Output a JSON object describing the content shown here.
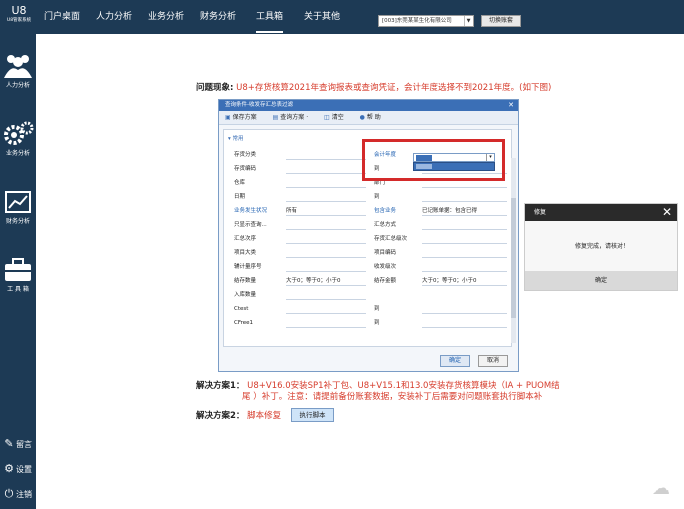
{
  "app": {
    "logo_mark": "U8",
    "logo_text": "U8管家系统"
  },
  "nav": {
    "items": [
      "门户桌面",
      "人力分析",
      "业务分析",
      "财务分析",
      "工具箱",
      "关于其他"
    ],
    "active": "工具箱"
  },
  "company_select": {
    "value": "[003]东莞某某生化有限公司"
  },
  "switch_button": "切换账套",
  "sidebar": {
    "items": [
      {
        "label": "人力分析",
        "icon": "people-icon"
      },
      {
        "label": "业务分析",
        "icon": "gears-icon"
      },
      {
        "label": "财务分析",
        "icon": "chart-icon"
      },
      {
        "label": "工 具 箱",
        "icon": "toolbox-icon"
      }
    ],
    "bottom": [
      {
        "label": "留言",
        "icon": "message-icon"
      },
      {
        "label": "设置",
        "icon": "gear-icon"
      },
      {
        "label": "注销",
        "icon": "power-icon"
      }
    ]
  },
  "problem": {
    "label": "问题现象:",
    "text": "U8+存货核算2021年查询报表或查询凭证，会计年度选择不到2021年度。(如下图)"
  },
  "dialog": {
    "title": "查询条件-收发存汇总表过滤",
    "toolbar": [
      "保存方案",
      "查询方案 ·",
      "清空",
      "帮 助"
    ],
    "group": "▾ 常用",
    "rows": [
      {
        "l1": "存货分类",
        "v1": "",
        "l2": "会计年度",
        "v2": ""
      },
      {
        "l1": "存货编码",
        "v1": "",
        "l2": "到",
        "v2": ""
      },
      {
        "l1": "仓库",
        "v1": "",
        "l2": "部门",
        "v2": ""
      },
      {
        "l1": "日期",
        "v1": "",
        "l2": "到",
        "v2": ""
      },
      {
        "l1": "业务发生状况",
        "v1": "所有",
        "l2": "包含业务",
        "v2": "已记账单据：包含已得"
      },
      {
        "l1": "只显示查询...",
        "v1": "",
        "l2": "汇总方式",
        "v2": ""
      },
      {
        "l1": "汇总次序",
        "v1": "",
        "l2": "存货汇总级次",
        "v2": ""
      },
      {
        "l1": "项目大类",
        "v1": "",
        "l2": "项目编码",
        "v2": ""
      },
      {
        "l1": "辅计量序号",
        "v1": "",
        "l2": "收发级次",
        "v2": ""
      },
      {
        "l1": "结存数量",
        "v1": "大于0；等于0；小于0",
        "l2": "结存金额",
        "v2": "大于0；等于0；小于0"
      },
      {
        "l1": "入库数量",
        "v1": "",
        "l2": "",
        "v2": ""
      },
      {
        "l1": "Ctest",
        "v1": "",
        "l2": "到",
        "v2": ""
      },
      {
        "l1": "CFree1",
        "v1": "",
        "l2": "到",
        "v2": ""
      }
    ],
    "ok": "确定",
    "cancel": "取消"
  },
  "repair": {
    "title": "修复",
    "message": "修复完成，请核对！",
    "ok": "确定"
  },
  "solution1": {
    "label": "解决方案1：",
    "line1": "U8+V16.0安装SP1补丁包、U8+V15.1和13.0安装存货核算模块（IA + PUOM结",
    "line2": "尾 ）补丁。注意：请提前备份账套数据，安装补丁后需要对问题账套执行脚本补"
  },
  "solution2": {
    "label": "解决方案2：",
    "text": "脚本修复",
    "button": "执行脚本"
  },
  "colors": {
    "nav_bg": "#1d3a55",
    "problem_red": "#d63b2b",
    "highlight_red": "#d42a2a",
    "dialog_blue": "#3b6fb6"
  }
}
